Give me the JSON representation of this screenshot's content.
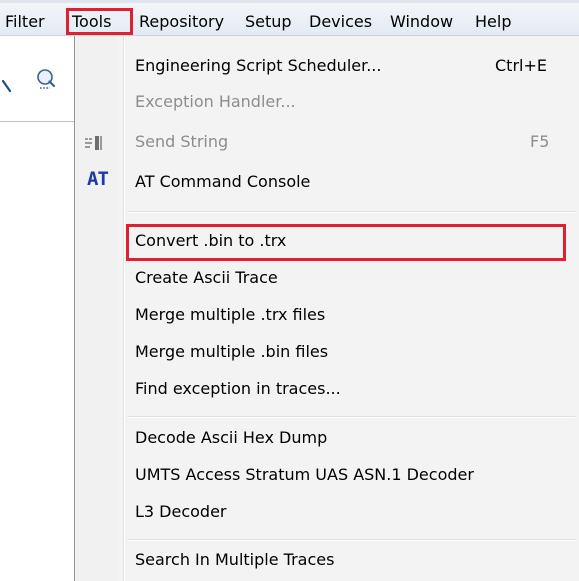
{
  "menubar": {
    "items": [
      {
        "key": "filter",
        "label": "Filter"
      },
      {
        "key": "tools",
        "label": "Tools"
      },
      {
        "key": "repository",
        "label": "Repository"
      },
      {
        "key": "setup",
        "label": "Setup"
      },
      {
        "key": "devices",
        "label": "Devices"
      },
      {
        "key": "window",
        "label": "Window"
      },
      {
        "key": "help",
        "label": "Help"
      }
    ]
  },
  "tools_menu": {
    "items": [
      {
        "label": "Engineering Script Scheduler...",
        "shortcut": "Ctrl+E",
        "enabled": true,
        "icon": ""
      },
      {
        "label": "Exception Handler...",
        "shortcut": "",
        "enabled": false,
        "icon": ""
      },
      {
        "label": "Send String",
        "shortcut": "F5",
        "enabled": false,
        "icon": "send-string-icon"
      },
      {
        "label": "AT Command Console",
        "shortcut": "",
        "enabled": true,
        "icon": "at-icon"
      },
      {
        "label": "Convert .bin to .trx",
        "shortcut": "",
        "enabled": true,
        "icon": "",
        "highlighted": true
      },
      {
        "label": "Create Ascii Trace",
        "shortcut": "",
        "enabled": true,
        "icon": ""
      },
      {
        "label": "Merge multiple .trx files",
        "shortcut": "",
        "enabled": true,
        "icon": ""
      },
      {
        "label": "Merge multiple .bin files",
        "shortcut": "",
        "enabled": true,
        "icon": ""
      },
      {
        "label": "Find exception in traces...",
        "shortcut": "",
        "enabled": true,
        "icon": ""
      },
      {
        "label": "Decode Ascii Hex Dump",
        "shortcut": "",
        "enabled": true,
        "icon": ""
      },
      {
        "label": "UMTS Access Stratum UAS ASN.1 Decoder",
        "shortcut": "",
        "enabled": true,
        "icon": ""
      },
      {
        "label": "L3 Decoder",
        "shortcut": "",
        "enabled": true,
        "icon": ""
      },
      {
        "label": "Search In Multiple Traces",
        "shortcut": "",
        "enabled": true,
        "icon": ""
      }
    ],
    "at_glyph": "AT"
  },
  "colors": {
    "highlight_border": "#e02030",
    "disabled_text": "#8d8d8d",
    "at_icon": "#1e3aa8"
  }
}
